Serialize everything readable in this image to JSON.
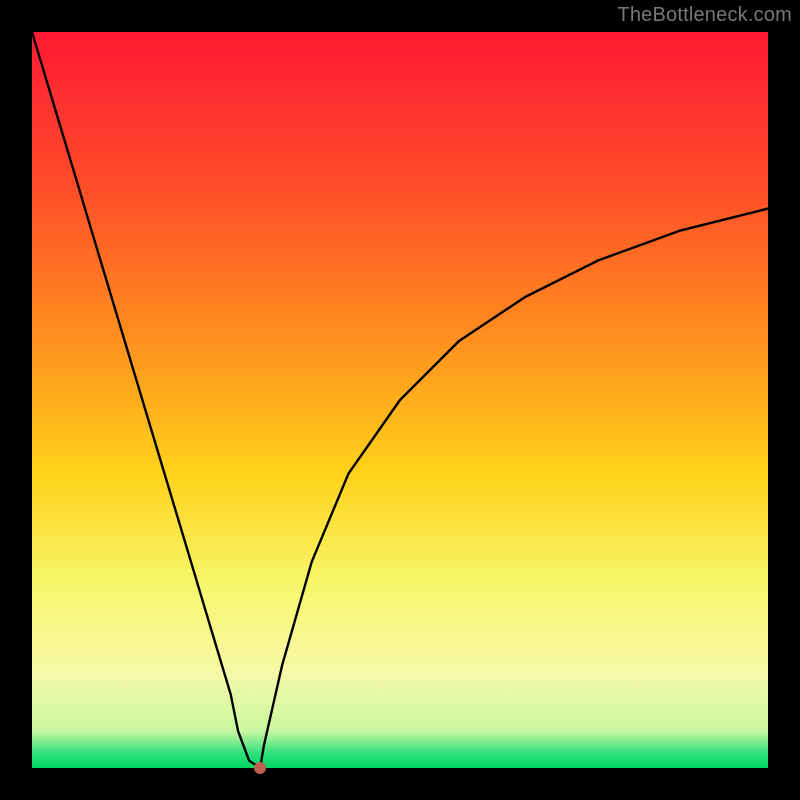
{
  "watermark": "TheBottleneck.com",
  "chart_data": {
    "type": "line",
    "title": "",
    "xlabel": "",
    "ylabel": "",
    "xlim": [
      0,
      100
    ],
    "ylim": [
      0,
      100
    ],
    "x": [
      0,
      3,
      6,
      9,
      12,
      15,
      18,
      21,
      24,
      27,
      28,
      29.5,
      31,
      31.5,
      34,
      38,
      43,
      50,
      58,
      67,
      77,
      88,
      100
    ],
    "values": [
      100,
      90,
      80,
      70,
      60,
      50,
      40,
      30,
      20,
      10,
      5,
      1,
      0,
      3,
      14,
      28,
      40,
      50,
      58,
      64,
      69,
      73,
      76
    ],
    "marker": {
      "x": 31,
      "y": 0
    },
    "gradient_stops": [
      {
        "pos": 0,
        "color": "#ff1a33"
      },
      {
        "pos": 20,
        "color": "#ff4a2a"
      },
      {
        "pos": 40,
        "color": "#ff8a1f"
      },
      {
        "pos": 60,
        "color": "#ffd21a"
      },
      {
        "pos": 75,
        "color": "#f7f76a"
      },
      {
        "pos": 87,
        "color": "#f7f9a8"
      },
      {
        "pos": 95,
        "color": "#c8f7a0"
      },
      {
        "pos": 98,
        "color": "#2fe07a"
      },
      {
        "pos": 100,
        "color": "#00d564"
      }
    ]
  }
}
